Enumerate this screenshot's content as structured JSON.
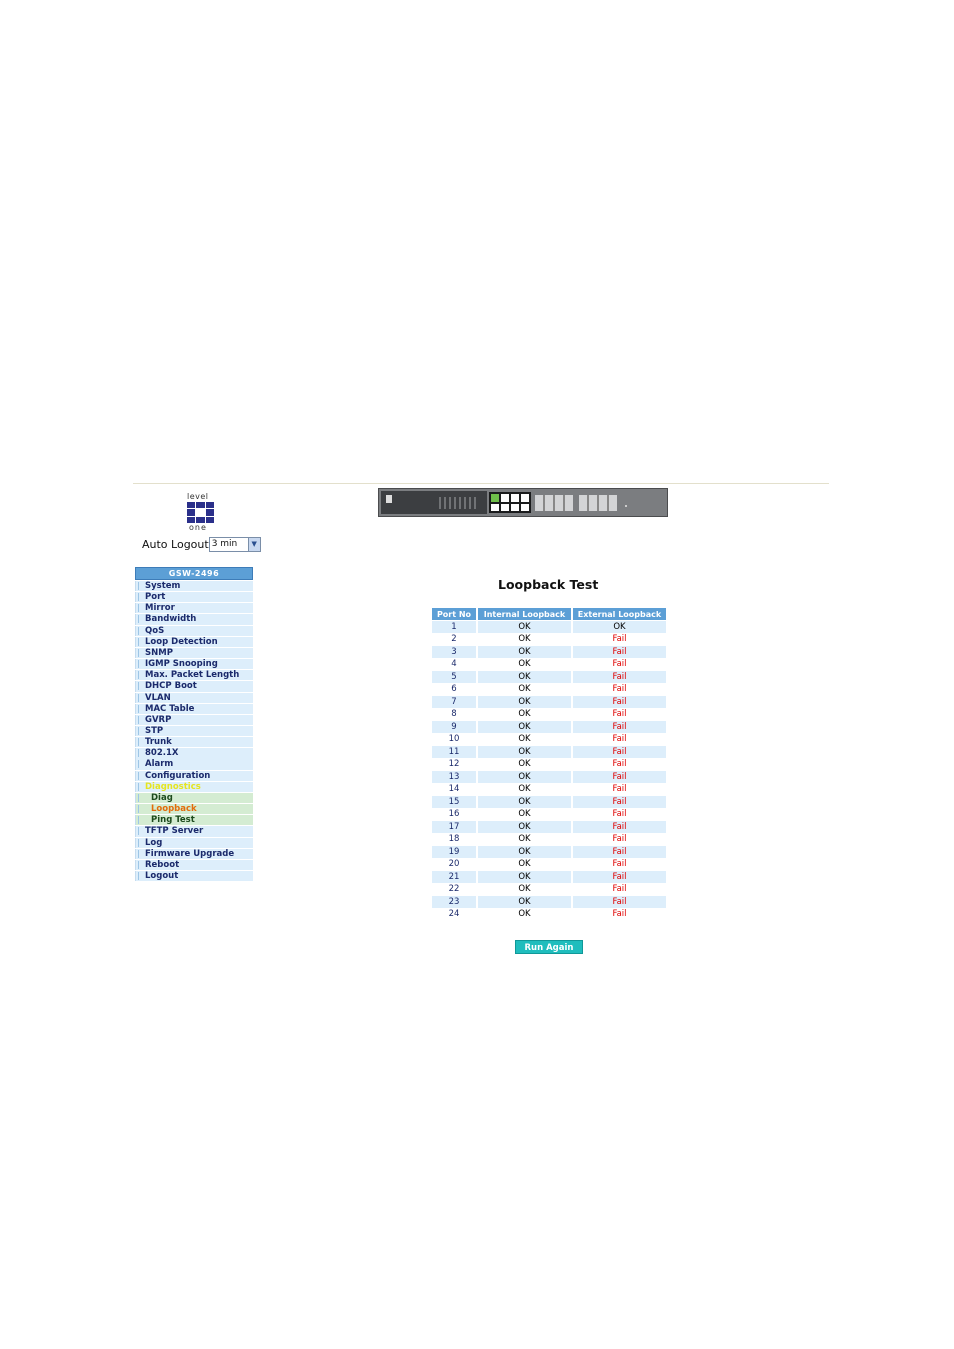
{
  "header": {
    "logo_top": "level",
    "logo_bottom": "one"
  },
  "auto_logout": {
    "label": "Auto Logout",
    "value": "3 min"
  },
  "sidebar": {
    "title": "GSW-2496",
    "items": [
      {
        "label": "System"
      },
      {
        "label": "Port"
      },
      {
        "label": "Mirror"
      },
      {
        "label": "Bandwidth"
      },
      {
        "label": "QoS"
      },
      {
        "label": "Loop Detection"
      },
      {
        "label": "SNMP"
      },
      {
        "label": "IGMP Snooping"
      },
      {
        "label": "Max. Packet Length"
      },
      {
        "label": "DHCP Boot"
      },
      {
        "label": "VLAN"
      },
      {
        "label": "MAC Table"
      },
      {
        "label": "GVRP"
      },
      {
        "label": "STP"
      },
      {
        "label": "Trunk"
      },
      {
        "label": "802.1X"
      },
      {
        "label": "Alarm"
      },
      {
        "label": "Configuration"
      },
      {
        "label": "Diagnostics",
        "kind": "group"
      },
      {
        "label": "Diag",
        "kind": "sub"
      },
      {
        "label": "Loopback",
        "kind": "sub",
        "active": true
      },
      {
        "label": "Ping Test",
        "kind": "sub"
      },
      {
        "label": "TFTP Server"
      },
      {
        "label": "Log"
      },
      {
        "label": "Firmware Upgrade"
      },
      {
        "label": "Reboot"
      },
      {
        "label": "Logout"
      }
    ]
  },
  "main": {
    "title": "Loopback Test",
    "columns": [
      "Port No",
      "Internal Loopback",
      "External Loopback"
    ],
    "rows": [
      [
        "1",
        "OK",
        "OK"
      ],
      [
        "2",
        "OK",
        "Fail"
      ],
      [
        "3",
        "OK",
        "Fail"
      ],
      [
        "4",
        "OK",
        "Fail"
      ],
      [
        "5",
        "OK",
        "Fail"
      ],
      [
        "6",
        "OK",
        "Fail"
      ],
      [
        "7",
        "OK",
        "Fail"
      ],
      [
        "8",
        "OK",
        "Fail"
      ],
      [
        "9",
        "OK",
        "Fail"
      ],
      [
        "10",
        "OK",
        "Fail"
      ],
      [
        "11",
        "OK",
        "Fail"
      ],
      [
        "12",
        "OK",
        "Fail"
      ],
      [
        "13",
        "OK",
        "Fail"
      ],
      [
        "14",
        "OK",
        "Fail"
      ],
      [
        "15",
        "OK",
        "Fail"
      ],
      [
        "16",
        "OK",
        "Fail"
      ],
      [
        "17",
        "OK",
        "Fail"
      ],
      [
        "18",
        "OK",
        "Fail"
      ],
      [
        "19",
        "OK",
        "Fail"
      ],
      [
        "20",
        "OK",
        "Fail"
      ],
      [
        "21",
        "OK",
        "Fail"
      ],
      [
        "22",
        "OK",
        "Fail"
      ],
      [
        "23",
        "OK",
        "Fail"
      ],
      [
        "24",
        "OK",
        "Fail"
      ]
    ],
    "run_again_label": "Run Again"
  },
  "colors": {
    "accent": "#5c9fd6",
    "fail": "#e00000",
    "button": "#1fbdbd"
  }
}
